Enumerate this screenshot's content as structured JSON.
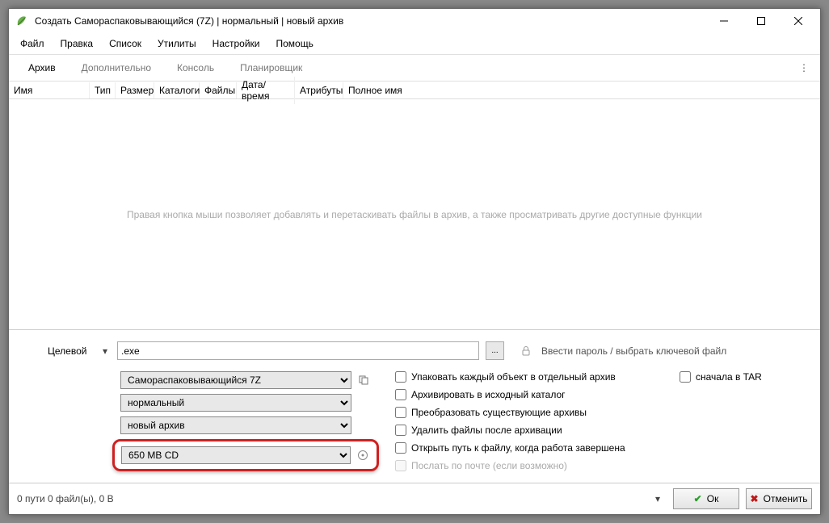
{
  "window": {
    "title": "Создать Самораспаковывающийся (7Z) | нормальный | новый архив"
  },
  "menu": {
    "file": "Файл",
    "edit": "Правка",
    "list": "Список",
    "utils": "Утилиты",
    "settings": "Настройки",
    "help": "Помощь"
  },
  "tabs": {
    "archive": "Архив",
    "extra": "Дополнительно",
    "console": "Консоль",
    "scheduler": "Планировщик"
  },
  "columns": {
    "name": "Имя",
    "type": "Тип",
    "size": "Размер",
    "folders": "Каталоги",
    "files": "Файлы",
    "datetime": "Дата/время",
    "attrs": "Атрибуты",
    "fullname": "Полное имя"
  },
  "hint": "Правая кнопка мыши позволяет добавлять и перетаскивать файлы в архив, а также просматривать другие доступные функции",
  "target": {
    "label": "Целевой",
    "value": ".exe",
    "browse": "...",
    "password": "Ввести пароль / выбрать ключевой файл"
  },
  "selects": {
    "format": "Самораспаковывающийся 7Z",
    "level": "нормальный",
    "mode": "новый архив",
    "split": "650 MB CD"
  },
  "checks": {
    "each": "Упаковать каждый объект в отдельный архив",
    "source": "Архивировать в исходный каталог",
    "convert": "Преобразовать существующие архивы",
    "delete": "Удалить файлы после архивации",
    "open": "Открыть путь к файлу, когда работа завершена",
    "mail": "Послать по почте (если возможно)",
    "tar": "сначала в TAR"
  },
  "status": "0 пути 0 файл(ы), 0 B",
  "buttons": {
    "ok": "Ок",
    "cancel": "Отменить"
  }
}
